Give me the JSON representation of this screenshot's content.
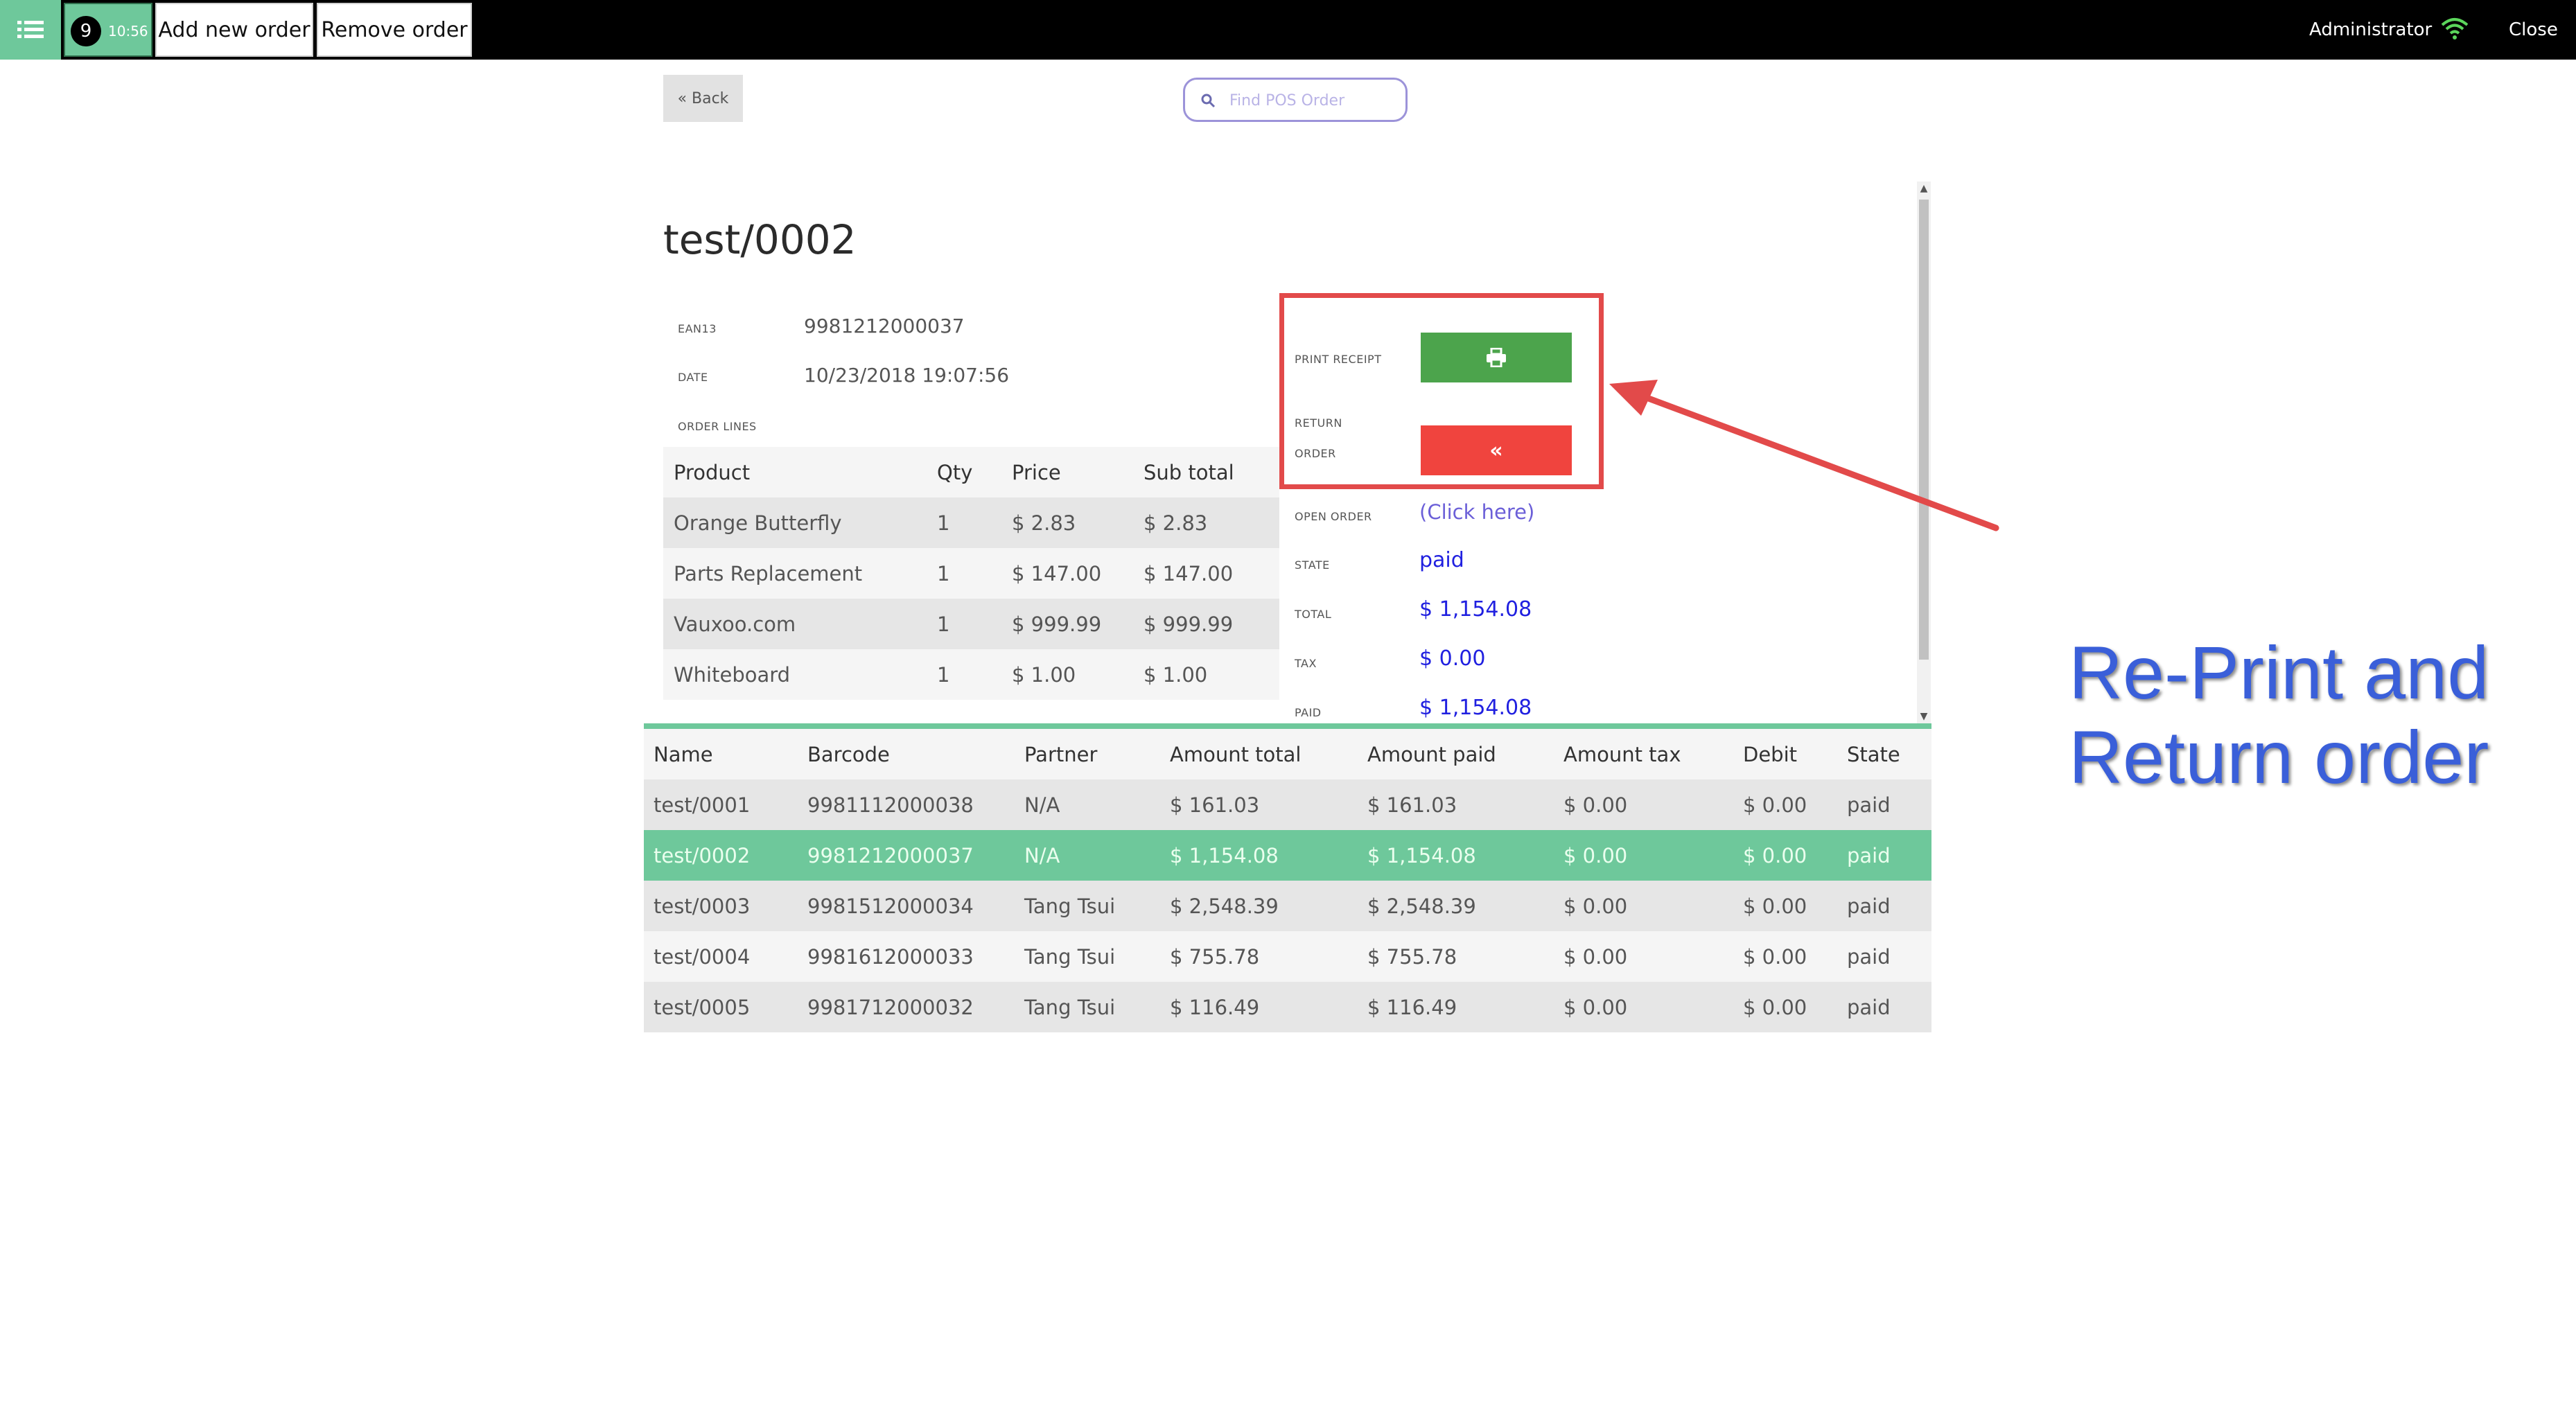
{
  "topbar": {
    "menu_icon": "list-icon",
    "order_number": "9",
    "order_time": "10:56",
    "add_order_label": "Add new order",
    "remove_order_label": "Remove order",
    "user": "Administrator",
    "wifi_icon": "wifi-icon",
    "close_label": "Close"
  },
  "nav": {
    "back_label": "« Back",
    "search_placeholder": "Find POS Order",
    "search_icon": "search-icon"
  },
  "detail": {
    "title": "test/0002",
    "ean_label": "EAN13",
    "ean": "9981212000037",
    "date_label": "DATE",
    "date": "10/23/2018 19:07:56",
    "order_lines_label": "ORDER LINES",
    "lines_headers": [
      "Product",
      "Qty",
      "Price",
      "Sub total"
    ],
    "lines": [
      {
        "product": "Orange Butterfly",
        "qty": "1",
        "price": "$ 2.83",
        "subtotal": "$ 2.83"
      },
      {
        "product": "Parts Replacement",
        "qty": "1",
        "price": "$ 147.00",
        "subtotal": "$ 147.00"
      },
      {
        "product": "Vauxoo.com",
        "qty": "1",
        "price": "$ 999.99",
        "subtotal": "$ 999.99"
      },
      {
        "product": "Whiteboard",
        "qty": "1",
        "price": "$ 1.00",
        "subtotal": "$ 1.00"
      }
    ],
    "print_receipt_label": "PRINT RECEIPT",
    "print_icon": "printer-icon",
    "return_label_1": "RETURN",
    "return_label_2": "ORDER",
    "return_icon": "«",
    "open_order_label": "OPEN ORDER",
    "open_order_link": "(Click here)",
    "state_label": "STATE",
    "state": "paid",
    "total_label": "TOTAL",
    "total": "$ 1,154.08",
    "tax_label": "TAX",
    "tax": "$ 0.00",
    "paid_label": "PAID",
    "paid": "$ 1,154.08"
  },
  "orders": {
    "headers": [
      "Name",
      "Barcode",
      "Partner",
      "Amount total",
      "Amount paid",
      "Amount tax",
      "Debit",
      "State"
    ],
    "rows": [
      {
        "name": "test/0001",
        "barcode": "9981112000038",
        "partner": "N/A",
        "total": "$ 161.03",
        "paid": "$ 161.03",
        "tax": "$ 0.00",
        "debit": "$ 0.00",
        "state": "paid"
      },
      {
        "name": "test/0002",
        "barcode": "9981212000037",
        "partner": "N/A",
        "total": "$ 1,154.08",
        "paid": "$ 1,154.08",
        "tax": "$ 0.00",
        "debit": "$ 0.00",
        "state": "paid"
      },
      {
        "name": "test/0003",
        "barcode": "9981512000034",
        "partner": "Tang Tsui",
        "total": "$ 2,548.39",
        "paid": "$ 2,548.39",
        "tax": "$ 0.00",
        "debit": "$ 0.00",
        "state": "paid"
      },
      {
        "name": "test/0004",
        "barcode": "9981612000033",
        "partner": "Tang Tsui",
        "total": "$ 755.78",
        "paid": "$ 755.78",
        "tax": "$ 0.00",
        "debit": "$ 0.00",
        "state": "paid"
      },
      {
        "name": "test/0005",
        "barcode": "9981712000032",
        "partner": "Tang Tsui",
        "total": "$ 116.49",
        "paid": "$ 116.49",
        "tax": "$ 0.00",
        "debit": "$ 0.00",
        "state": "paid"
      }
    ]
  },
  "annotation": {
    "line1": "Re-Print and",
    "line2": "Return order"
  },
  "colors": {
    "accent_green": "#6ec89b",
    "print_green": "#4ca44c",
    "return_red": "#f0443e",
    "highlight_red": "#e24a4a",
    "link_purple": "#6b5fd8",
    "value_blue": "#2020e0",
    "annotation_blue": "#3a5fd9"
  }
}
